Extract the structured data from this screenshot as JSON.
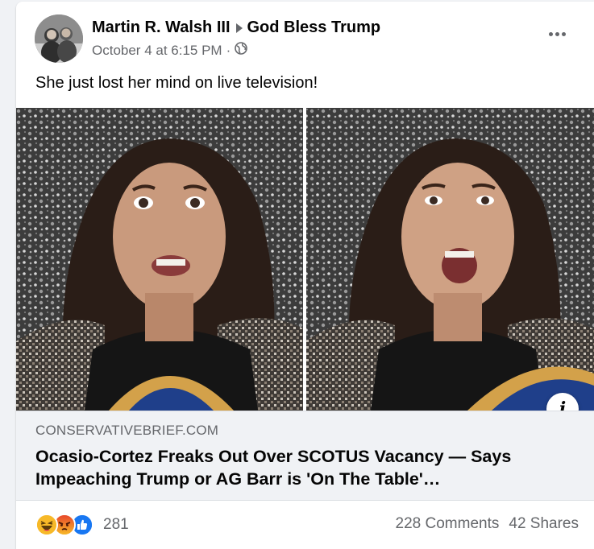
{
  "post": {
    "author": "Martin R. Walsh III",
    "group": "God Bless Trump",
    "timestamp": "October 4 at 6:15 PM",
    "separator": "·",
    "privacy_icon": "globe-icon",
    "more_icon": "more-options-icon",
    "text": "She just lost her mind on live television!"
  },
  "link": {
    "domain": "CONSERVATIVEBRIEF.COM",
    "headline": "Ocasio-Cortez Freaks Out Over SCOTUS Vacancy — Says Impeaching Trump or AG Barr is 'On The Table'…",
    "info_label": "i"
  },
  "engagement": {
    "reaction_icons": [
      "haha-reaction-icon",
      "angry-reaction-icon",
      "like-reaction-icon"
    ],
    "reaction_count": "281",
    "comments": "228 Comments",
    "shares": "42 Shares"
  },
  "colors": {
    "secondary_text": "#65676b",
    "link_box_bg": "#f0f2f5",
    "like_blue": "#1877f2"
  }
}
